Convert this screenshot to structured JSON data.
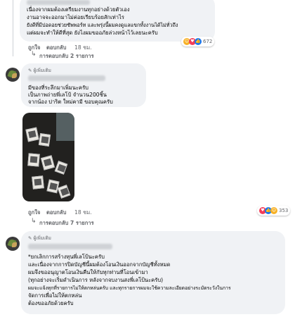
{
  "comment1": {
    "header_partial": "[ชื่อถูกเซ็นเซอร์] ...",
    "lines": [
      "เนื่องจากผมต้องเตรียมงานทุกอย่างด้วยตัวเอง",
      "งานอาจจะออกมาไม่ค่อยเรียบร้อยสักเท่าไร",
      "ยังดีที่มีปอดอยช่วยซัพพอร์ท และพรุ่งนี้ผมคงดูแลแขกทั้งงานได้ไม่ทั่วถึง",
      "แต่ผมจะทำให้ดีที่สุด ยังไงผมขออภัยล่วงหน้าไว้เลยนะครับ"
    ],
    "reaction_count": "672",
    "like_label": "ถูกใจ",
    "reply_label": "ตอบกลับ",
    "time": "18 ชม.",
    "replies_label": "การตอบกลับ 2 รายการ"
  },
  "comment2": {
    "badge": "ผู้เพิ่มเติม",
    "lines": [
      "มีของที่ระลึกมาเพิ่มนะครับ",
      "เป็นภาพถ่ายพี่เลโป้ จำนวน200ชิ้น",
      "จากน้อง ปาริต ใหม่คามี ขอบคุณครับ"
    ],
    "reaction_count": "353",
    "like_label": "ถูกใจ",
    "reply_label": "ตอบกลับ",
    "time": "18 ชม.",
    "replies_label": "การตอบกลับ 7 รายการ"
  },
  "comment3": {
    "badge": "ผู้เพิ่มเติม",
    "lines": [
      "*ยกเลิกการสร้างทุนพี่เลโป้นะครับ",
      "และเนื่องจากการปิดบัญชีนี้ผมต้องโอนเงินออกจากบัญชีทั้งหมด",
      "ผมจึงขออนุญาตโอนเงินคืนให้กับทุกท่านที่โอนเข้ามา",
      "(ทุกอย่างจะเริ่มดำเนินการ หลังจากจบงานสงพี่เลโป้นะครับ)",
      "ผมจะแจ้งทุกที่รายการไม่ให้ตกหล่นครับ และทุกรายการผมจะใช้ความละเอียดอย่างระมัดระวังในการ",
      "จัดการเพื่อไม่ให้ตกหล่น",
      "ต้องขออภัยด้วยครับ"
    ]
  },
  "colors": {
    "bubble": "#f0f2f5",
    "meta": "#65676b",
    "like_blue": "#1877f2",
    "love_red": "#f33e58",
    "haha_yellow": "#f7b125"
  },
  "icons": [
    "avatar",
    "contributor-badge-icon",
    "love-reaction-icon",
    "haha-reaction-icon",
    "like-reaction-icon",
    "reply-arrow-icon"
  ]
}
